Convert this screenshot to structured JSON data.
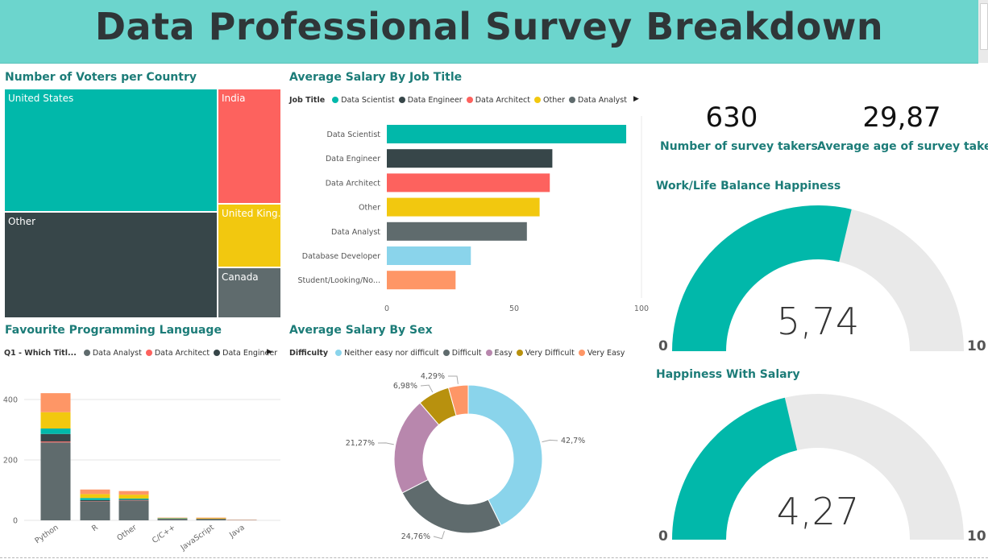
{
  "header": {
    "title": "Data Professional Survey Breakdown"
  },
  "treemap": {
    "title": "Number of Voters per Country",
    "cells": [
      {
        "label": "United States",
        "color": "#01b8aa"
      },
      {
        "label": "India",
        "color": "#fd625e"
      },
      {
        "label": "Other",
        "color": "#374649"
      },
      {
        "label": "United King...",
        "color": "#f2c80f"
      },
      {
        "label": "Canada",
        "color": "#5f6b6d"
      }
    ]
  },
  "salary_job": {
    "title": "Average Salary By Job Title",
    "legend_title": "Job Title",
    "legend": [
      {
        "label": "Data Scientist",
        "color": "#01b8aa"
      },
      {
        "label": "Data Engineer",
        "color": "#374649"
      },
      {
        "label": "Data Architect",
        "color": "#fd625e"
      },
      {
        "label": "Other",
        "color": "#f2c80f"
      },
      {
        "label": "Data Analyst",
        "color": "#5f6b6d"
      }
    ]
  },
  "lang": {
    "title": "Favourite Programming Language",
    "legend_title": "Q1 - Which Titl...",
    "legend": [
      {
        "label": "Data Analyst",
        "color": "#5f6b6d"
      },
      {
        "label": "Data Architect",
        "color": "#fd625e"
      },
      {
        "label": "Data Engineer",
        "color": "#374649"
      }
    ]
  },
  "sex": {
    "title": "Average Salary By Sex",
    "legend_title": "Difficulty",
    "legend": [
      {
        "label": "Neither easy nor difficult",
        "color": "#8ad4eb"
      },
      {
        "label": "Difficult",
        "color": "#5f6b6d"
      },
      {
        "label": "Easy",
        "color": "#b887ad"
      },
      {
        "label": "Very Difficult",
        "color": "#b8910e"
      },
      {
        "label": "Very Easy",
        "color": "#fe9666"
      }
    ]
  },
  "kpi": {
    "takers_value": "630",
    "takers_label": "Number of survey takers",
    "age_value": "29,87",
    "age_label": "Average age of survey takers"
  },
  "gauge_wlb": {
    "title": "Work/Life Balance Happiness",
    "value_text": "5,74",
    "min": "0",
    "max": "10"
  },
  "gauge_salary": {
    "title": "Happiness With Salary",
    "value_text": "4,27",
    "min": "0",
    "max": "10"
  },
  "chart_data": [
    {
      "type": "treemap",
      "title": "Number of Voters per Country",
      "categories": [
        "United States",
        "Other",
        "India",
        "United Kingdom",
        "Canada"
      ]
    },
    {
      "type": "bar",
      "orientation": "horizontal",
      "title": "Average Salary By Job Title",
      "categories": [
        "Data Scientist",
        "Data Engineer",
        "Data Architect",
        "Other",
        "Data Analyst",
        "Database Developer",
        "Student/Looking/No..."
      ],
      "values": [
        94,
        65,
        64,
        60,
        55,
        33,
        27
      ],
      "colors": [
        "#01b8aa",
        "#374649",
        "#fd625e",
        "#f2c80f",
        "#5f6b6d",
        "#8ad4eb",
        "#fe9666"
      ],
      "xlim": [
        0,
        100
      ],
      "xticks": [
        "0",
        "50",
        "100"
      ]
    },
    {
      "type": "bar",
      "stacked": true,
      "title": "Favourite Programming Language",
      "categories": [
        "Python",
        "R",
        "Other",
        "C/C++",
        "JavaScript",
        "Java"
      ],
      "series": [
        {
          "name": "Data Analyst",
          "color": "#5f6b6d",
          "values": [
            258,
            62,
            66,
            5,
            4,
            1
          ]
        },
        {
          "name": "Data Architect",
          "color": "#fd625e",
          "values": [
            3,
            1,
            1,
            0,
            0,
            0
          ]
        },
        {
          "name": "Data Engineer",
          "color": "#374649",
          "values": [
            25,
            4,
            2,
            1,
            1,
            0
          ]
        },
        {
          "color": "#01b8aa",
          "values": [
            18,
            7,
            3,
            1,
            0,
            0
          ]
        },
        {
          "color": "#f2c80f",
          "values": [
            54,
            13,
            13,
            1,
            2,
            0
          ]
        },
        {
          "color": "#fe9666",
          "values": [
            63,
            15,
            12,
            1,
            2,
            1
          ]
        }
      ],
      "ylim": [
        0,
        450
      ],
      "yticks": [
        "0",
        "200",
        "400"
      ]
    },
    {
      "type": "pie",
      "donut": true,
      "title": "Average Salary By Sex",
      "categories": [
        "Neither easy nor difficult",
        "Difficult",
        "Easy",
        "Very Difficult",
        "Very Easy"
      ],
      "values": [
        42.7,
        24.76,
        21.27,
        6.98,
        4.29
      ],
      "labels": [
        "42,7%",
        "24,76%",
        "21,27%",
        "6,98%",
        "4,29%"
      ],
      "colors": [
        "#8ad4eb",
        "#5f6b6d",
        "#b887ad",
        "#b8910e",
        "#fe9666"
      ]
    },
    {
      "type": "gauge",
      "title": "Work/Life Balance Happiness",
      "value": 5.74,
      "min": 0,
      "max": 10
    },
    {
      "type": "gauge",
      "title": "Happiness With Salary",
      "value": 4.27,
      "min": 0,
      "max": 10
    }
  ]
}
